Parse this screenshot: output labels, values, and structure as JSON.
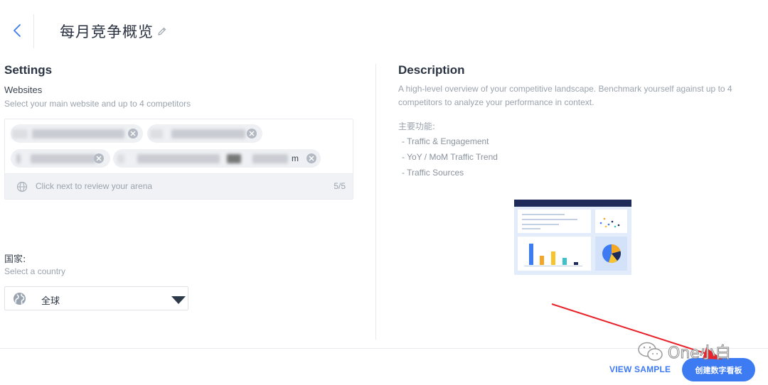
{
  "header": {
    "title": "每月竞争概览"
  },
  "settings": {
    "title": "Settings",
    "websites_label": "Websites",
    "websites_hint": "Select your main website and up to 4 competitors",
    "chip_fragment": "m",
    "arena_hint": "Click next to review your arena",
    "arena_count": "5/5",
    "country_label": "国家:",
    "country_hint": "Select a country",
    "country_value": "全球"
  },
  "description": {
    "title": "Description",
    "text": "A high-level overview of your competitive landscape. Benchmark yourself against up to 4 competitors to analyze your performance in context.",
    "features_label": "主要功能:",
    "features": [
      "- Traffic & Engagement",
      "- YoY / MoM Traffic Trend",
      "- Traffic Sources"
    ]
  },
  "footer": {
    "view_sample": "VIEW SAMPLE",
    "create_button": "创建数字看板"
  },
  "watermark": {
    "text": "One小白"
  },
  "colors": {
    "accent": "#3d7bf2",
    "arrow": "#e8232a",
    "illustration_bar": "#1e2a5a",
    "chart_blue": "#3d7bf2",
    "chart_orange": "#f5a623",
    "chart_yellow": "#f8c32b",
    "chart_teal": "#3ec1c9"
  },
  "icons": [
    "chevron-left-icon",
    "pencil-icon",
    "globe-icon",
    "close-icon",
    "caret-down-icon",
    "wechat-icon"
  ]
}
